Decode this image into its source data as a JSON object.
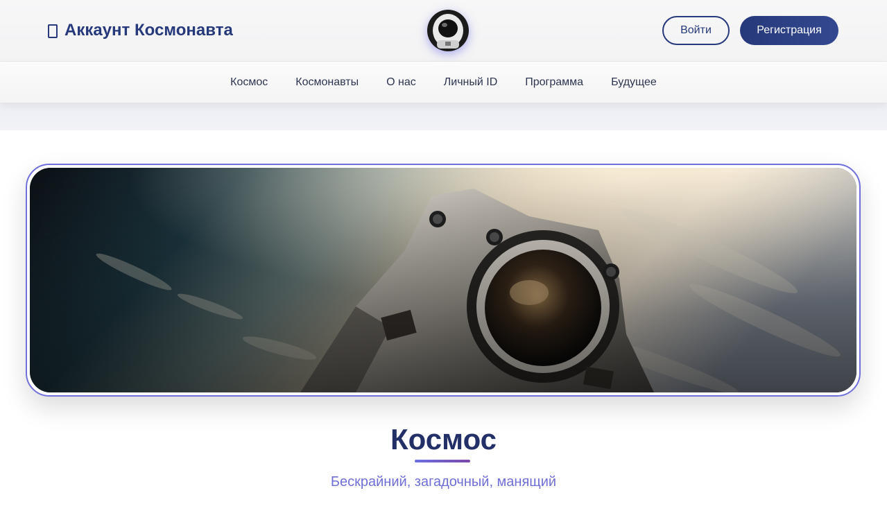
{
  "header": {
    "brand_icon": "id-card-icon",
    "brand_title": "Аккаунт Космонавта",
    "avatar_icon": "astronaut-avatar",
    "login_label": "Войти",
    "register_label": "Регистрация"
  },
  "nav": {
    "items": [
      {
        "label": "Космос"
      },
      {
        "label": "Космонавты"
      },
      {
        "label": "О нас"
      },
      {
        "label": "Личный ID"
      },
      {
        "label": "Программа"
      },
      {
        "label": "Будущее"
      }
    ]
  },
  "hero": {
    "image": "astronaut-in-orbit-photo",
    "title": "Космос",
    "subtitle": "Бескрайний, загадочный, манящий"
  },
  "colors": {
    "primary": "#26397a",
    "accent": "#7070dd",
    "title": "#233068",
    "subtitle": "#6f6fd6",
    "underline_start": "#6a6fe0",
    "underline_end": "#7c48a8"
  }
}
